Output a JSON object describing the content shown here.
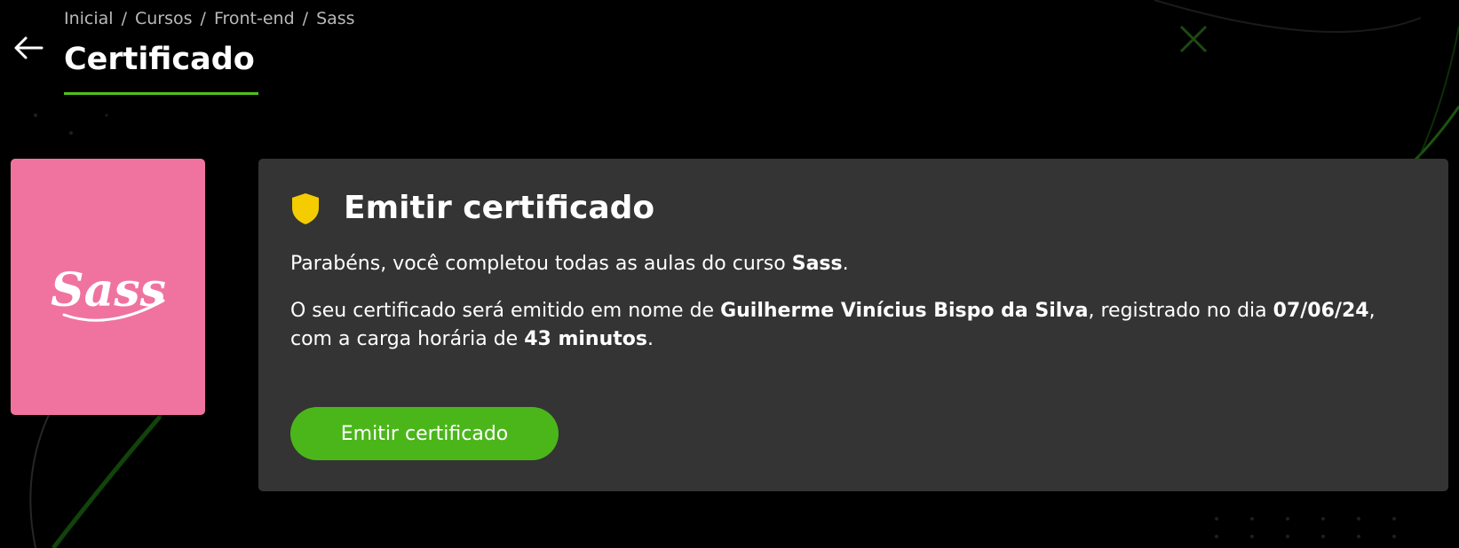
{
  "breadcrumb": {
    "items": [
      "Inicial",
      "Cursos",
      "Front-end",
      "Sass"
    ],
    "separator": "/"
  },
  "page": {
    "title": "Certificado"
  },
  "course": {
    "logo_text": "Sass",
    "card_color": "#f0739f"
  },
  "panel": {
    "title": "Emitir certificado",
    "congrats_prefix": "Parabéns, você completou todas as aulas do curso ",
    "course_name": "Sass",
    "congrats_suffix": ".",
    "issue_prefix": "O seu certificado será emitido em nome de ",
    "student_name": "Guilherme Vinícius Bispo da Silva",
    "registered_text": ", registrado no dia ",
    "date": "07/06/24",
    "workload_text": ", com a carga horária de ",
    "workload": "43 minutos",
    "end_punct": ".",
    "button_label": "Emitir certificado"
  },
  "icons": {
    "back": "arrow-left-icon",
    "shield": "shield-icon",
    "logo": "sass-logo"
  },
  "colors": {
    "accent_green": "#4bb61a",
    "underline_green": "#4fbf1a",
    "shield_yellow": "#f5cc00",
    "panel_bg": "#343434"
  }
}
